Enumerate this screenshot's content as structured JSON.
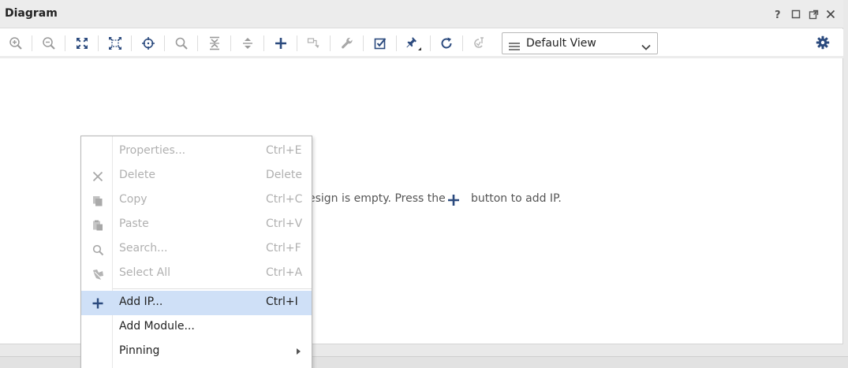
{
  "panel": {
    "title": "Diagram",
    "controls": [
      "help-icon",
      "restore-icon",
      "float-icon",
      "close-icon"
    ]
  },
  "toolbar": {
    "view_select": {
      "selected": "Default View"
    },
    "buttons": [
      "zoom-in-icon",
      "zoom-out-icon",
      "fit-full-screen-icon",
      "fit-selection-icon",
      "locate-icon",
      "search-icon",
      "collapse-icon",
      "expand-icon",
      "add-icon",
      "route-icon",
      "wrench-icon",
      "validate-icon",
      "pin-icon",
      "refresh-icon",
      "regenerate-icon",
      "settings-icon"
    ]
  },
  "canvas": {
    "hint_before": "esign is empty. Press the",
    "hint_after": "button to add IP."
  },
  "context_menu": {
    "items": [
      {
        "label": "Properties...",
        "shortcut": "Ctrl+E",
        "icon": "",
        "enabled": false
      },
      {
        "label": "Delete",
        "shortcut": "Delete",
        "icon": "delete-x-icon",
        "enabled": false
      },
      {
        "label": "Copy",
        "shortcut": "Ctrl+C",
        "icon": "copy-icon",
        "enabled": false
      },
      {
        "label": "Paste",
        "shortcut": "Ctrl+V",
        "icon": "paste-icon",
        "enabled": false
      },
      {
        "label": "Search...",
        "shortcut": "Ctrl+F",
        "icon": "search-icon",
        "enabled": false
      },
      {
        "label": "Select All",
        "shortcut": "Ctrl+A",
        "icon": "select-all-icon",
        "enabled": false
      },
      {
        "label": "Add IP...",
        "shortcut": "Ctrl+I",
        "icon": "add-icon",
        "enabled": true,
        "highlighted": true
      },
      {
        "label": "Add Module...",
        "shortcut": "",
        "icon": "",
        "enabled": true
      },
      {
        "label": "Pinning",
        "shortcut": "",
        "icon": "",
        "enabled": true,
        "submenu": true
      }
    ]
  },
  "colors": {
    "accent": "#2b4a7e",
    "highlight": "#cfe0f7",
    "disabled_text": "#b0b0b0"
  }
}
